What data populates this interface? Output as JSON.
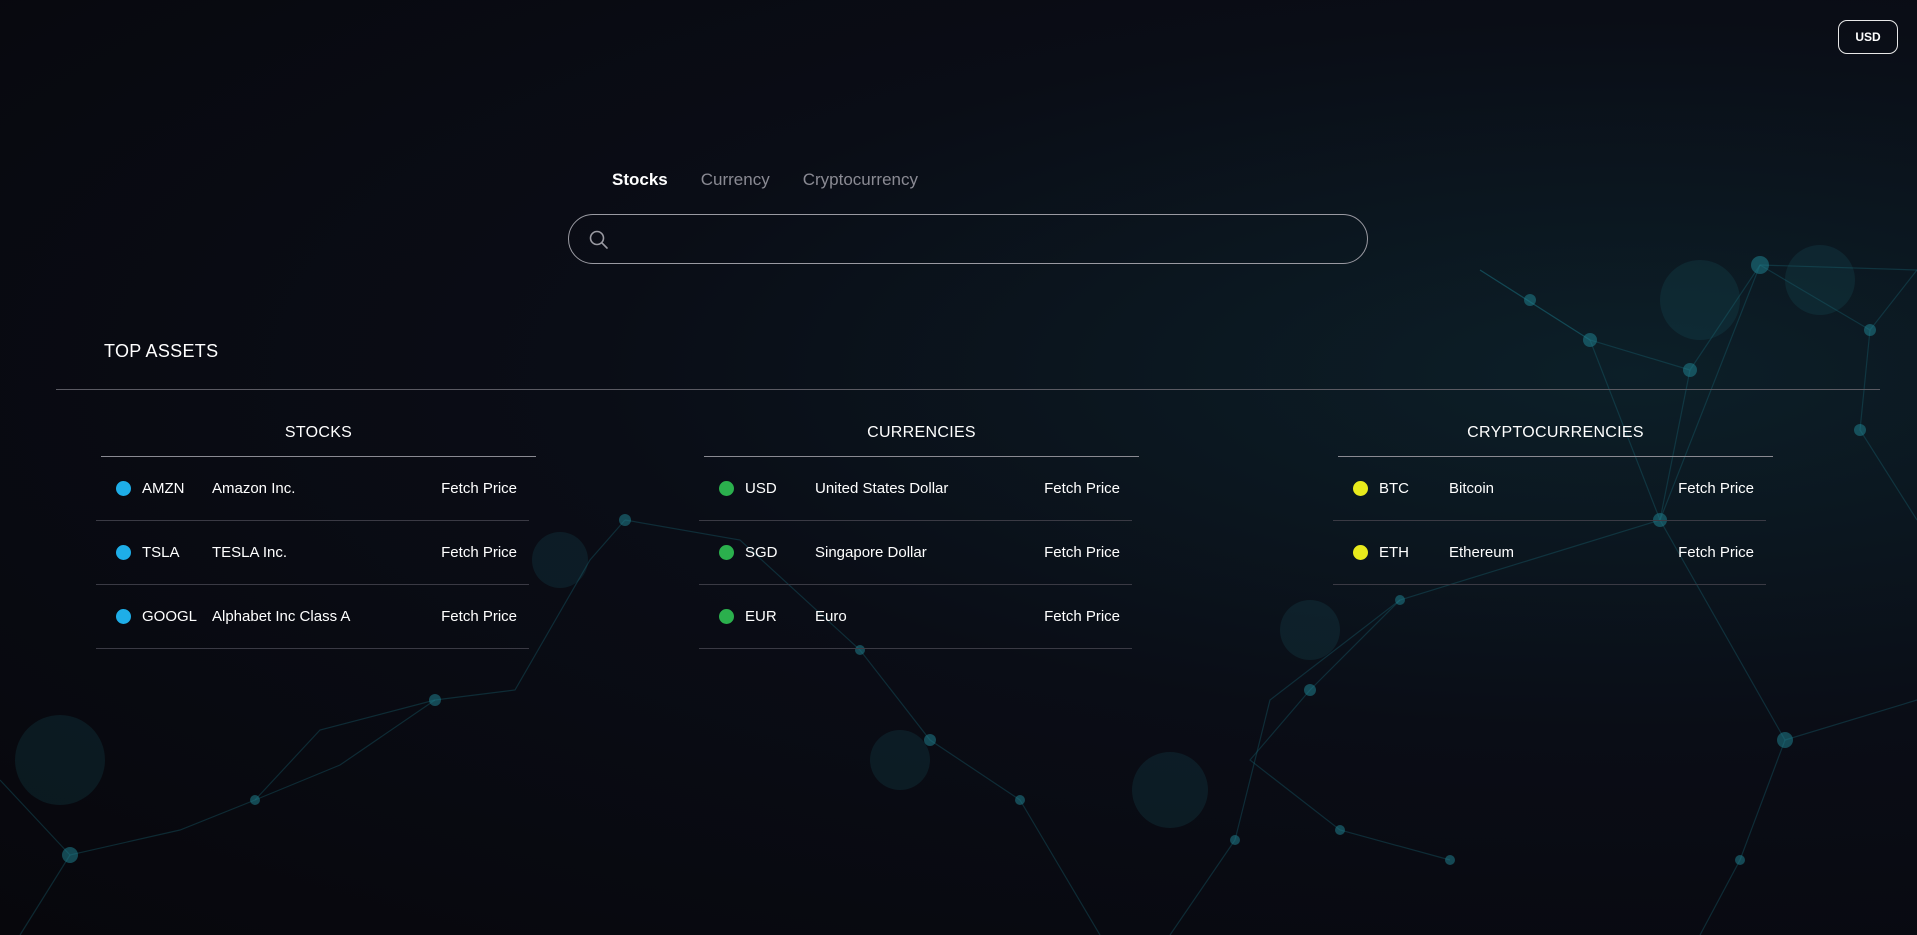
{
  "header": {
    "currency_button": "USD"
  },
  "tabs": [
    {
      "label": "Stocks",
      "active": true
    },
    {
      "label": "Currency",
      "active": false
    },
    {
      "label": "Cryptocurrency",
      "active": false
    }
  ],
  "search": {
    "placeholder": "",
    "value": ""
  },
  "top_assets": {
    "title": "TOP ASSETS",
    "columns": [
      {
        "title": "STOCKS",
        "dot_color": "#1eaee8",
        "rows": [
          {
            "symbol": "AMZN",
            "name": "Amazon Inc.",
            "action": "Fetch Price"
          },
          {
            "symbol": "TSLA",
            "name": "TESLA Inc.",
            "action": "Fetch Price"
          },
          {
            "symbol": "GOOGL",
            "name": "Alphabet Inc Class A",
            "action": "Fetch Price"
          }
        ]
      },
      {
        "title": "CURRENCIES",
        "dot_color": "#2bb04d",
        "rows": [
          {
            "symbol": "USD",
            "name": "United States Dollar",
            "action": "Fetch Price"
          },
          {
            "symbol": "SGD",
            "name": "Singapore Dollar",
            "action": "Fetch Price"
          },
          {
            "symbol": "EUR",
            "name": "Euro",
            "action": "Fetch Price"
          }
        ]
      },
      {
        "title": "CRYPTOCURRENCIES",
        "dot_color": "#e8ea1c",
        "rows": [
          {
            "symbol": "BTC",
            "name": "Bitcoin",
            "action": "Fetch Price"
          },
          {
            "symbol": "ETH",
            "name": "Ethereum",
            "action": "Fetch Price"
          }
        ]
      }
    ]
  },
  "icons": {
    "search": "search-icon"
  }
}
